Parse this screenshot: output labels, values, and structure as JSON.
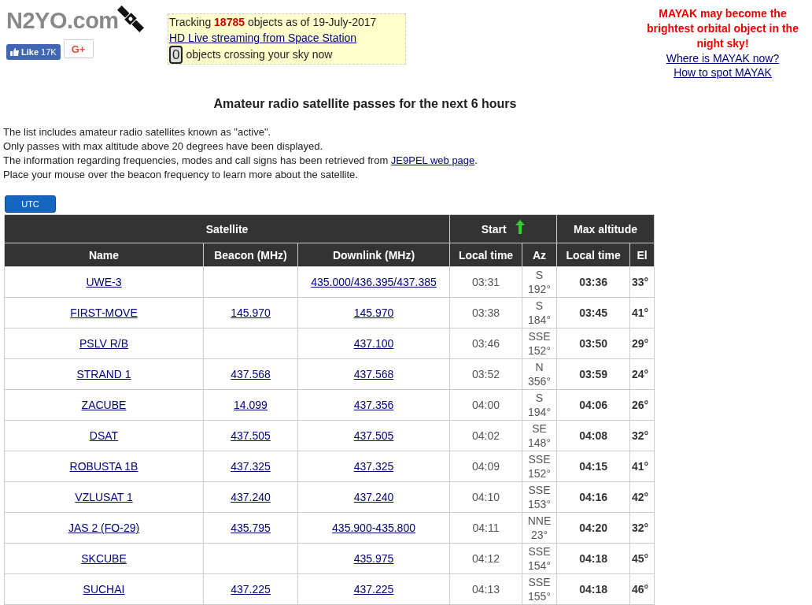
{
  "header": {
    "logo": "N2YO.com",
    "like_label": "Like",
    "like_count": "17K",
    "gplus": "G+",
    "tracking_prefix": "Tracking",
    "tracking_count": "18785",
    "tracking_suffix": "objects as of 19-July-2017",
    "live_link": "HD Live streaming from Space Station",
    "crossing_count": "0",
    "crossing_text": "objects crossing your sky now"
  },
  "promo": {
    "headline": "MAYAK may become the brightest orbital object in the night sky!",
    "links": [
      "Where is MAYAK now?",
      "How to spot MAYAK"
    ]
  },
  "title": "Amateur radio satellite passes for the next 6 hours",
  "intro": [
    "The list includes amateur radio satellites known as \"active\".",
    "Only passes with max altitude above 20 degrees have been displayed."
  ],
  "source_line": {
    "before": "The information regarding frequencies, modes and call signs has been retrieved from",
    "link": "JE9PEL web page",
    "after": "."
  },
  "hint": "Place your mouse over the beacon frequency to learn more about the satellite.",
  "utc_button": "UTC",
  "table": {
    "groups": [
      {
        "label": "Satellite",
        "sorted": false
      },
      {
        "label": "Start",
        "sorted": true
      },
      {
        "label": "Max altitude",
        "sorted": false
      }
    ],
    "columns": [
      "Name",
      "Beacon (MHz)",
      "Downlink (MHz)",
      "Local time",
      "Az",
      "Local time",
      "El"
    ],
    "rows": [
      {
        "name": "UWE-3",
        "beacon": "",
        "downlink": "435.000/436.395/437.385",
        "start": "03:31",
        "az": "S\n192°",
        "max_time": "03:36",
        "el": "33°"
      },
      {
        "name": "FIRST-MOVE",
        "beacon": "145.970",
        "downlink": "145.970",
        "start": "03:38",
        "az": "S\n184°",
        "max_time": "03:45",
        "el": "41°"
      },
      {
        "name": "PSLV R/B",
        "beacon": "",
        "downlink": "437.100",
        "start": "03:46",
        "az": "SSE\n152°",
        "max_time": "03:50",
        "el": "29°"
      },
      {
        "name": "STRAND 1",
        "beacon": "437.568",
        "downlink": "437.568",
        "start": "03:52",
        "az": "N\n356°",
        "max_time": "03:59",
        "el": "24°"
      },
      {
        "name": "ZACUBE",
        "beacon": "14.099",
        "downlink": "437.356",
        "start": "04:00",
        "az": "S\n194°",
        "max_time": "04:06",
        "el": "26°"
      },
      {
        "name": "DSAT",
        "beacon": "437.505",
        "downlink": "437.505",
        "start": "04:02",
        "az": "SE\n148°",
        "max_time": "04:08",
        "el": "32°"
      },
      {
        "name": "ROBUSTA 1B",
        "beacon": "437.325",
        "downlink": "437.325",
        "start": "04:09",
        "az": "SSE\n152°",
        "max_time": "04:15",
        "el": "41°"
      },
      {
        "name": "VZLUSAT 1",
        "beacon": "437.240",
        "downlink": "437.240",
        "start": "04:10",
        "az": "SSE\n153°",
        "max_time": "04:16",
        "el": "42°"
      },
      {
        "name": "JAS 2 (FO-29)",
        "beacon": "435.795",
        "downlink": "435.900-435.800",
        "start": "04:11",
        "az": "NNE\n23°",
        "max_time": "04:20",
        "el": "32°"
      },
      {
        "name": "SKCUBE",
        "beacon": "",
        "downlink": "435.975",
        "start": "04:12",
        "az": "SSE\n154°",
        "max_time": "04:18",
        "el": "45°"
      },
      {
        "name": "SUCHAI",
        "beacon": "437.225",
        "downlink": "437.225",
        "start": "04:13",
        "az": "SSE\n155°",
        "max_time": "04:18",
        "el": "46°"
      }
    ]
  }
}
